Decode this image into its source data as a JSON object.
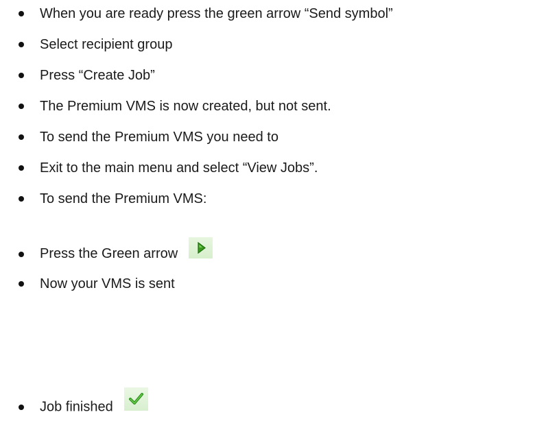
{
  "items": [
    "When you are ready press the green arrow “Send symbol”",
    "Select recipient group",
    "Press “Create Job”",
    "The Premium VMS is now created, but not sent.",
    "To send the Premium VMS you need to",
    "Exit to the main menu and select “View Jobs”.",
    "To send the Premium VMS:",
    "Press the Green arrow",
    "Now your VMS is sent",
    "Job finished"
  ],
  "icons": {
    "send_icon": "green-play-arrow-icon",
    "finished_icon": "green-checkmark-icon"
  },
  "colors": {
    "green_arrow": "#3a9a1e",
    "check": "#2f8f1f"
  }
}
